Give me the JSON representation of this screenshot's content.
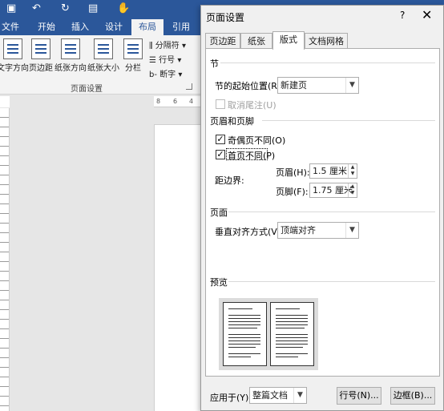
{
  "word": {
    "tabs": [
      "文件",
      "开始",
      "插入",
      "设计",
      "布局",
      "引用"
    ],
    "active_tab": "布局",
    "ribbon_buttons": [
      "文字方向",
      "页边距",
      "纸张方向",
      "纸张大小",
      "分栏"
    ],
    "small_buttons": [
      "分隔符",
      "行号",
      "断字"
    ],
    "group_label": "页面设置",
    "ruler_numbers": [
      "8",
      "6",
      "4"
    ]
  },
  "dialog": {
    "title": "页面设置",
    "help": "?",
    "close": "✕",
    "tabs": [
      "页边距",
      "纸张",
      "版式",
      "文档网格"
    ],
    "active_tab": "版式",
    "section": {
      "heading": "节",
      "start_label": "节的起始位置(R):",
      "start_value": "新建页",
      "suppress_endnotes": "取消尾注(U)"
    },
    "header_footer": {
      "heading": "页眉和页脚",
      "odd_even": "奇偶页不同(O)",
      "first_page": "首页不同(P)",
      "from_edge_label": "距边界:",
      "header_label": "页眉(H):",
      "header_value": "1.5 厘米",
      "footer_label": "页脚(F):",
      "footer_value": "1.75 厘米"
    },
    "page": {
      "heading": "页面",
      "valign_label": "垂直对齐方式(V):",
      "valign_value": "顶端对齐"
    },
    "preview": {
      "heading": "预览"
    },
    "apply_label": "应用于(Y):",
    "apply_value": "整篇文档",
    "line_numbers_button": "行号(N)...",
    "borders_button": "边框(B)..."
  }
}
